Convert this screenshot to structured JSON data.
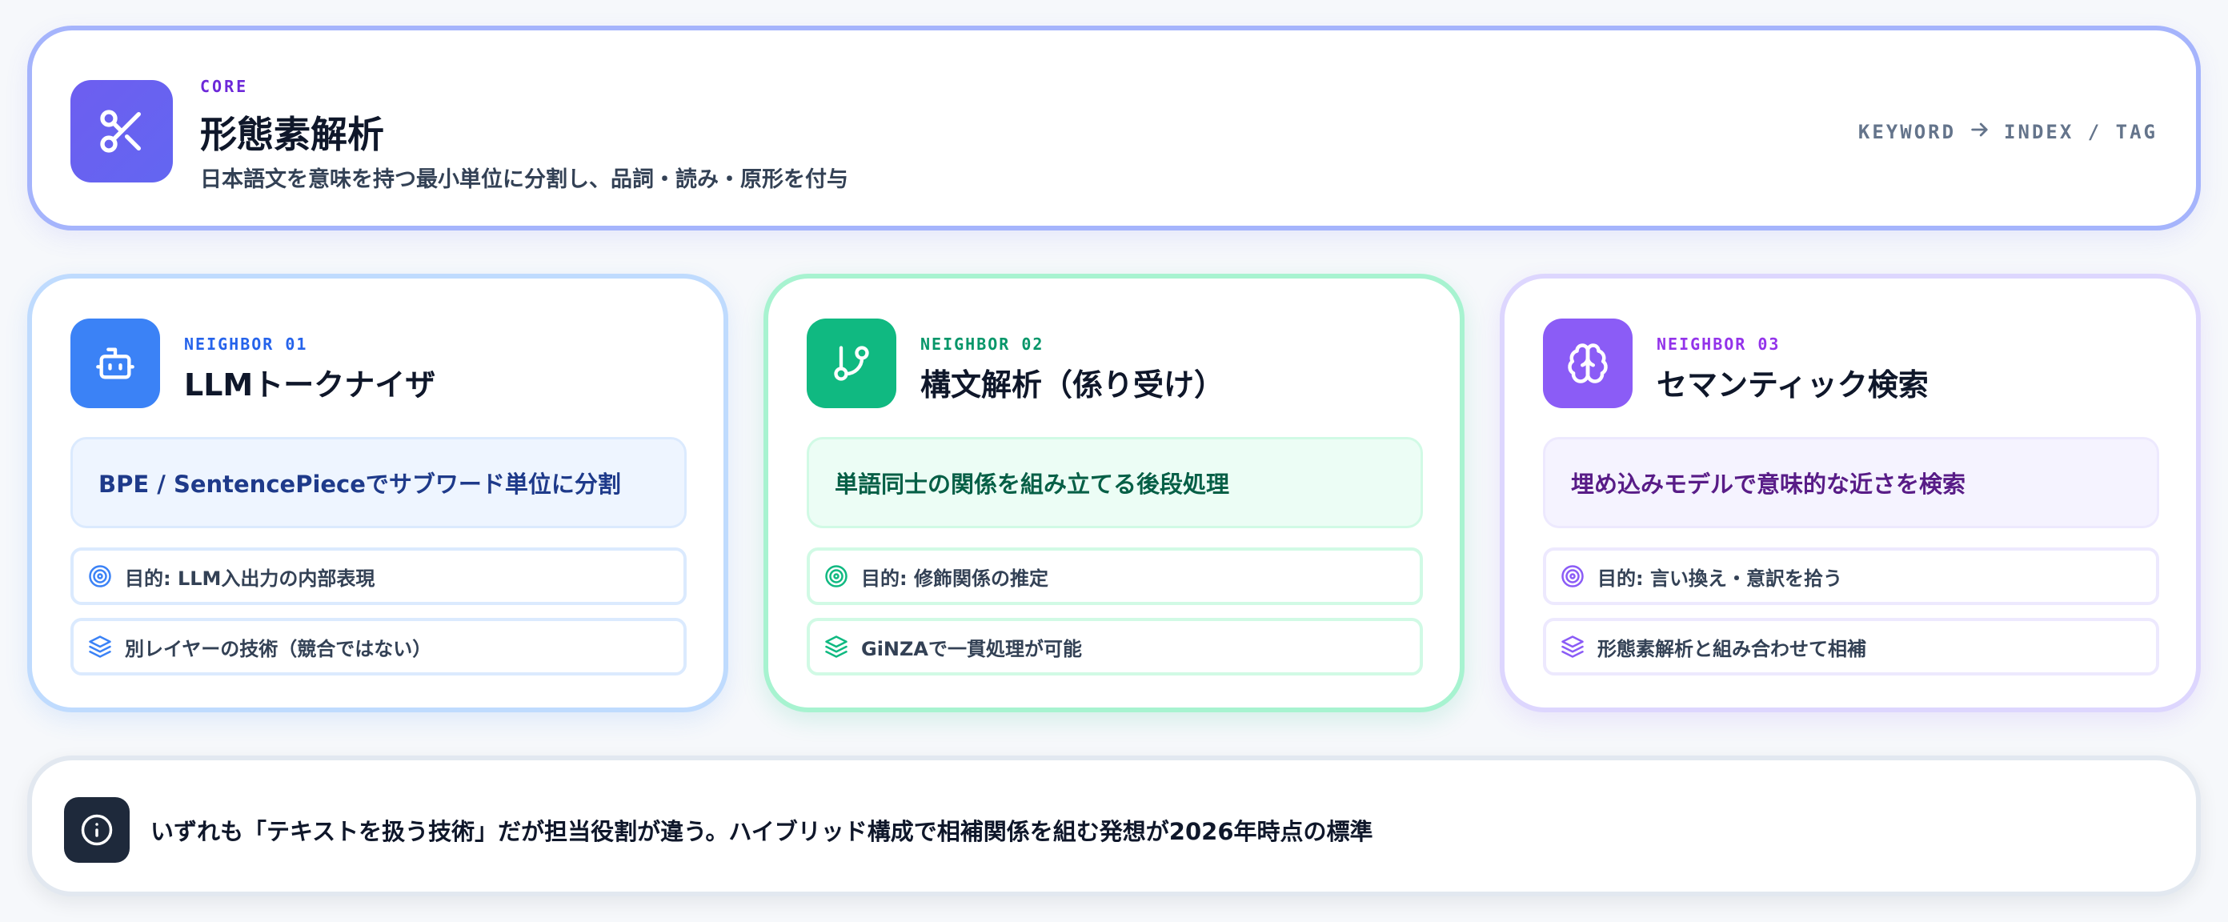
{
  "core": {
    "eyebrow": "CORE",
    "title": "形態素解析",
    "subtitle": "日本語文を意味を持つ最小単位に分割し、品詞・読み・原形を付与",
    "flow": {
      "from": "KEYWORD",
      "to": "INDEX / TAG"
    },
    "icon": "scissors-icon",
    "accent": "#6366f1"
  },
  "neighbors": [
    {
      "eyebrow": "NEIGHBOR 01",
      "title": "LLMトークナイザ",
      "lead": "BPE / SentencePieceでサブワード単位に分割",
      "purpose": "目的: LLM入出力の内部表現",
      "note": "別レイヤーの技術（競合ではない）",
      "icon": "robot-icon",
      "accent": "#3b82f6"
    },
    {
      "eyebrow": "NEIGHBOR 02",
      "title": "構文解析（係り受け）",
      "lead": "単語同士の関係を組み立てる後段処理",
      "purpose": "目的: 修飾関係の推定",
      "note": "GiNZAで一貫処理が可能",
      "icon": "git-branch-icon",
      "accent": "#10b981"
    },
    {
      "eyebrow": "NEIGHBOR 03",
      "title": "セマンティック検索",
      "lead": "埋め込みモデルで意味的な近さを検索",
      "purpose": "目的: 言い換え・意訳を拾う",
      "note": "形態素解析と組み合わせて相補",
      "icon": "brain-icon",
      "accent": "#8b5cf6"
    }
  ],
  "footer": {
    "text": "いずれも「テキストを扱う技術」だが担当役割が違う。ハイブリッド構成で相補関係を組む発想が2026年時点の標準",
    "icon": "info-icon"
  }
}
